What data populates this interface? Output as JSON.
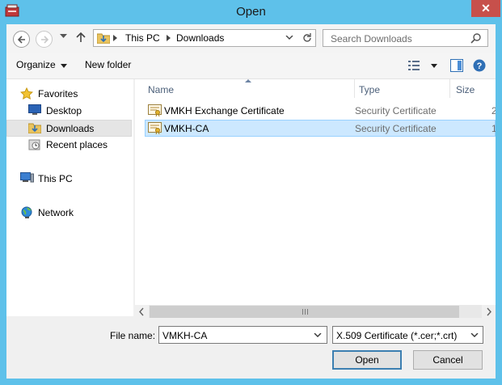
{
  "window": {
    "title": "Open",
    "close_glyph": "✕"
  },
  "address": {
    "segments": [
      "This PC",
      "Downloads"
    ],
    "search_placeholder": "Search Downloads"
  },
  "toolbar": {
    "organize": "Organize",
    "new_folder": "New folder"
  },
  "nav": {
    "items": [
      {
        "label": "Favorites",
        "icon": "star-icon"
      },
      {
        "label": "Desktop",
        "icon": "desktop-icon"
      },
      {
        "label": "Downloads",
        "icon": "downloads-folder-icon",
        "selected": true
      },
      {
        "label": "Recent places",
        "icon": "recent-places-icon"
      },
      {
        "label": "This PC",
        "icon": "computer-icon"
      },
      {
        "label": "Network",
        "icon": "network-icon"
      }
    ]
  },
  "columns": {
    "name": "Name",
    "type": "Type",
    "size": "Size"
  },
  "files": [
    {
      "name": "VMKH Exchange Certificate",
      "type": "Security Certificate",
      "size": "2",
      "selected": false
    },
    {
      "name": "VMKH-CA",
      "type": "Security Certificate",
      "size": "1",
      "selected": true
    }
  ],
  "bottom": {
    "file_name_label": "File name:",
    "file_name_value": "VMKH-CA",
    "file_type_value": "X.509 Certificate (*.cer;*.crt)",
    "open_button": "Open",
    "cancel_button": "Cancel"
  },
  "colors": {
    "frame": "#5ec1ea",
    "selection": "#cce8ff",
    "close": "#c7504b"
  }
}
